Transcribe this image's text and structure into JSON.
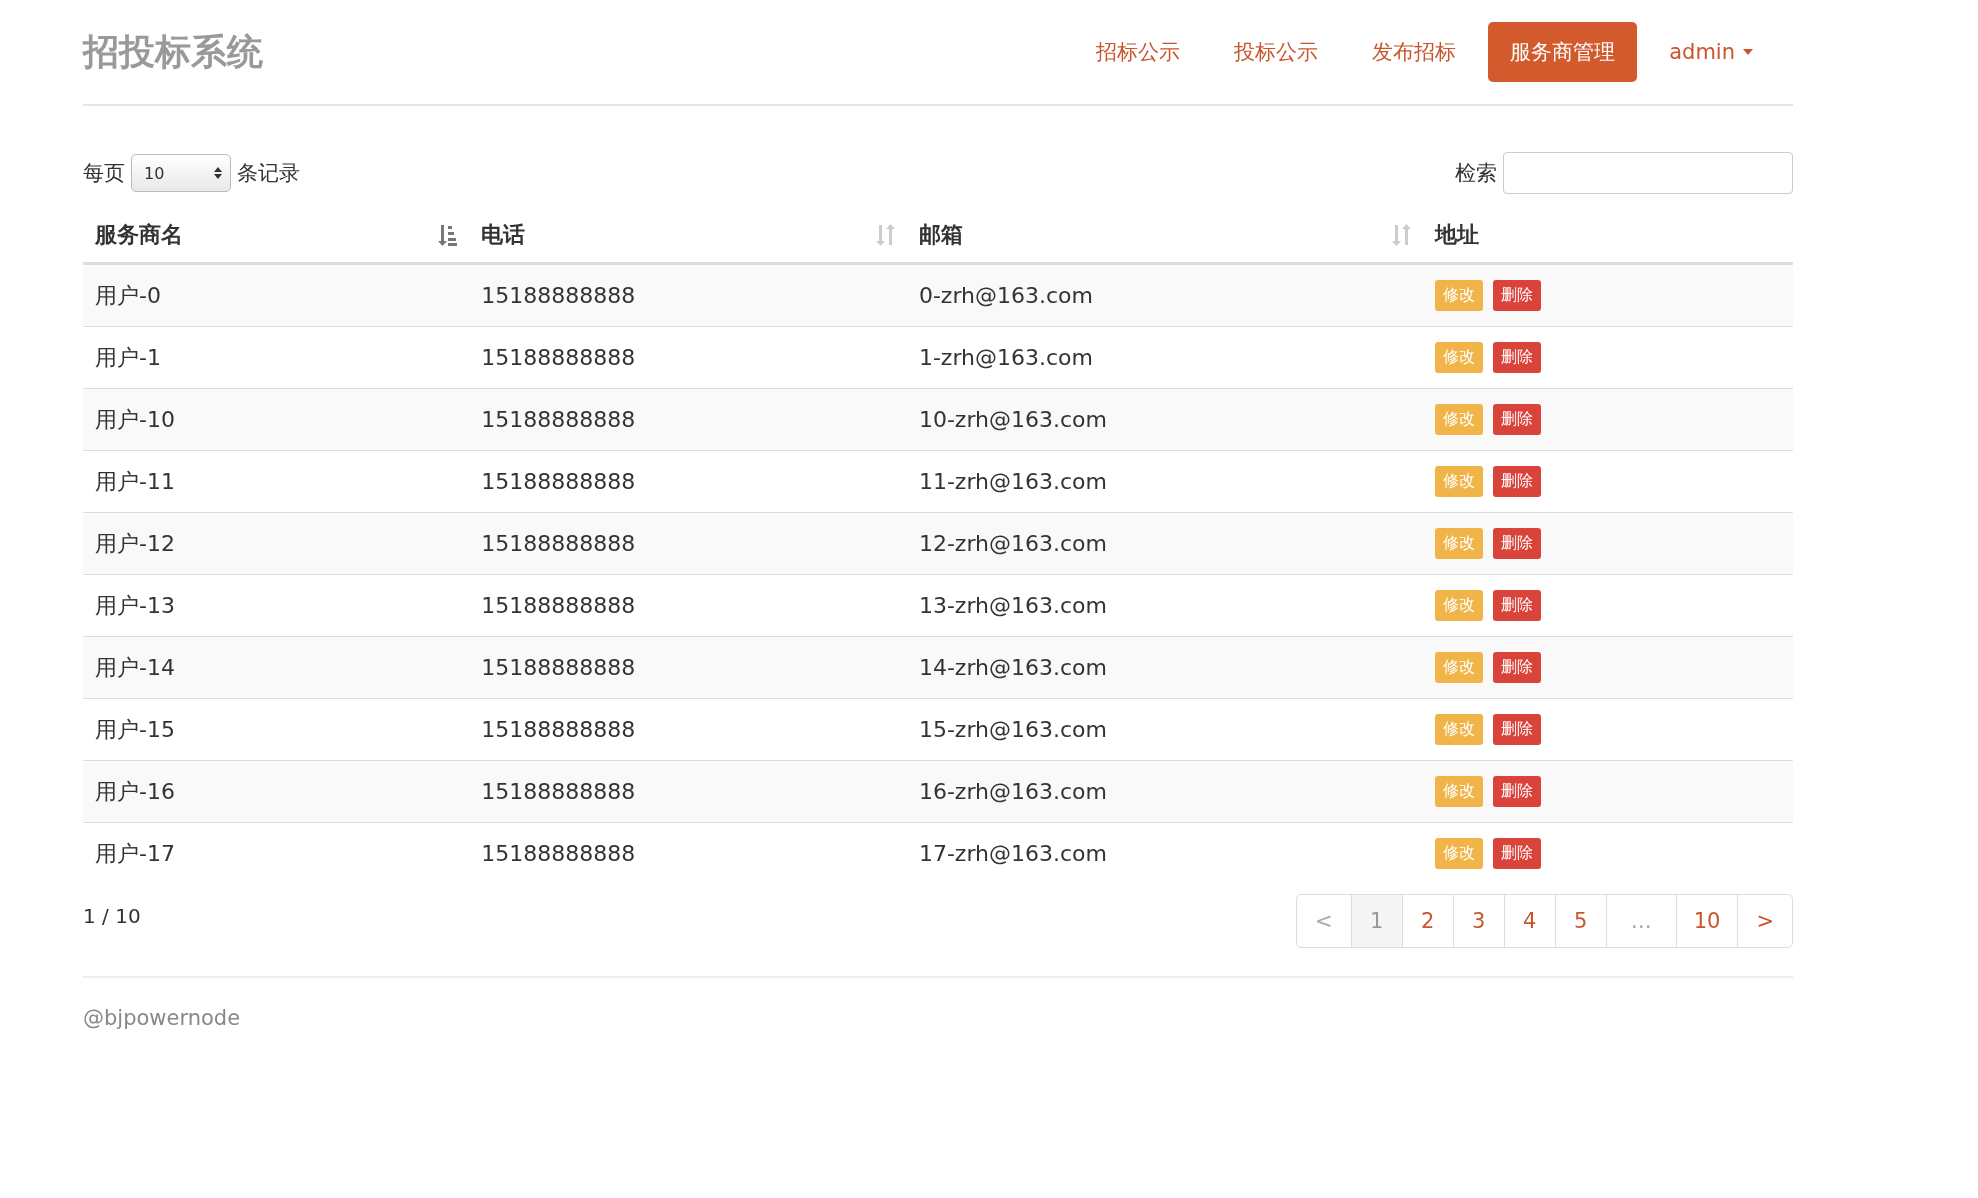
{
  "brand": "招投标系统",
  "nav": [
    {
      "label": "招标公示",
      "selected": false
    },
    {
      "label": "投标公示",
      "selected": false
    },
    {
      "label": "发布招标",
      "selected": false
    },
    {
      "label": "服务商管理",
      "selected": true
    }
  ],
  "user_menu": {
    "label": "admin"
  },
  "page_size": {
    "prefix": "每页",
    "value": "10",
    "suffix": "条记录"
  },
  "search": {
    "label": "检索"
  },
  "table": {
    "columns": [
      {
        "label": "服务商名",
        "sortable": true,
        "sorted": true
      },
      {
        "label": "电话",
        "sortable": true,
        "sorted": false
      },
      {
        "label": "邮箱",
        "sortable": true,
        "sorted": false
      },
      {
        "label": "地址",
        "sortable": false
      }
    ],
    "rows": [
      {
        "name": "用户-0",
        "phone": "15188888888",
        "email": "0-zrh@163.com",
        "actions": [
          "修改",
          "删除"
        ]
      },
      {
        "name": "用户-1",
        "phone": "15188888888",
        "email": "1-zrh@163.com",
        "actions": [
          "修改",
          "删除"
        ]
      },
      {
        "name": "用户-10",
        "phone": "15188888888",
        "email": "10-zrh@163.com",
        "actions": [
          "修改",
          "删除"
        ]
      },
      {
        "name": "用户-11",
        "phone": "15188888888",
        "email": "11-zrh@163.com",
        "actions": [
          "修改",
          "删除"
        ]
      },
      {
        "name": "用户-12",
        "phone": "15188888888",
        "email": "12-zrh@163.com",
        "actions": [
          "修改",
          "删除"
        ]
      },
      {
        "name": "用户-13",
        "phone": "15188888888",
        "email": "13-zrh@163.com",
        "actions": [
          "修改",
          "删除"
        ]
      },
      {
        "name": "用户-14",
        "phone": "15188888888",
        "email": "14-zrh@163.com",
        "actions": [
          "修改",
          "删除"
        ]
      },
      {
        "name": "用户-15",
        "phone": "15188888888",
        "email": "15-zrh@163.com",
        "actions": [
          "修改",
          "删除"
        ]
      },
      {
        "name": "用户-16",
        "phone": "15188888888",
        "email": "16-zrh@163.com",
        "actions": [
          "修改",
          "删除"
        ]
      },
      {
        "name": "用户-17",
        "phone": "15188888888",
        "email": "17-zrh@163.com",
        "actions": [
          "修改",
          "删除"
        ]
      }
    ]
  },
  "page_info": "1 / 10",
  "pagination": [
    {
      "label": "<",
      "kind": "prev",
      "selected": false,
      "disabled": true
    },
    {
      "label": "1",
      "kind": "page",
      "selected": true,
      "disabled": false
    },
    {
      "label": "2",
      "kind": "page",
      "selected": false,
      "disabled": false
    },
    {
      "label": "3",
      "kind": "page",
      "selected": false,
      "disabled": false
    },
    {
      "label": "4",
      "kind": "page",
      "selected": false,
      "disabled": false
    },
    {
      "label": "5",
      "kind": "page",
      "selected": false,
      "disabled": false
    },
    {
      "label": "…",
      "kind": "ellipsis",
      "selected": false,
      "disabled": true
    },
    {
      "label": "10",
      "kind": "page",
      "selected": false,
      "disabled": false
    },
    {
      "label": ">",
      "kind": "next",
      "selected": false,
      "disabled": false
    }
  ],
  "footer": "@bjpowernode"
}
